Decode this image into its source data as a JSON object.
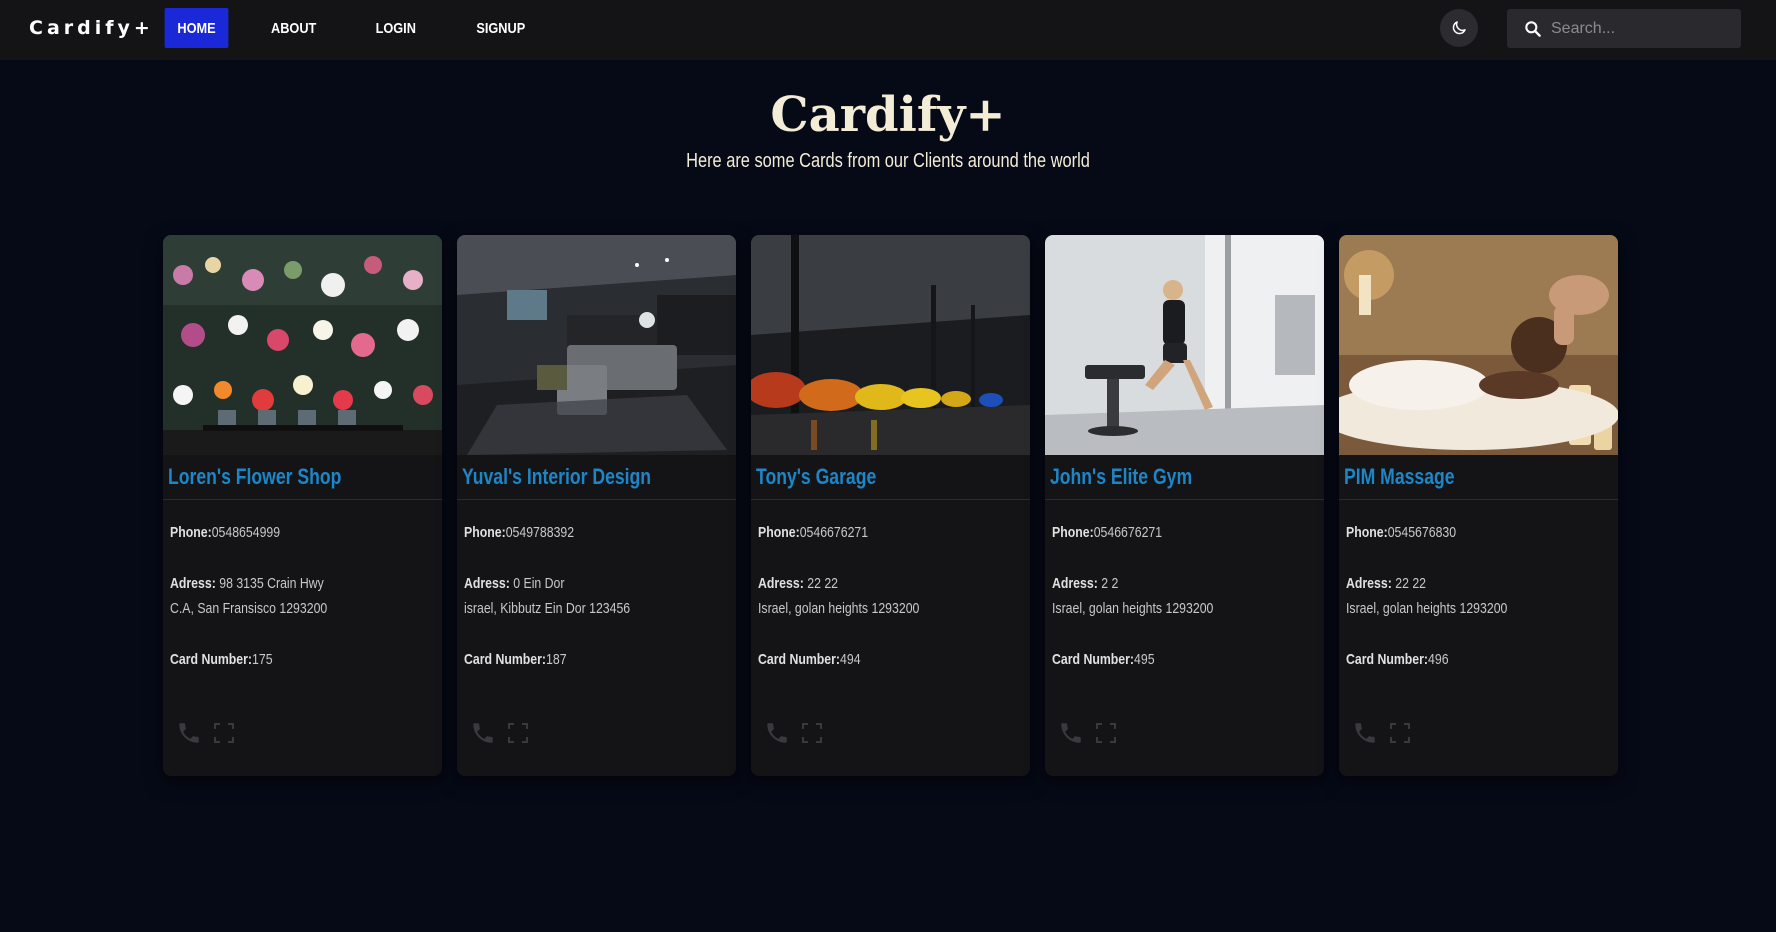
{
  "nav": {
    "brand": "Cardify+",
    "links": [
      "HOME",
      "ABOUT",
      "LOGIN",
      "SIGNUP"
    ],
    "active": "HOME",
    "theme_icon": "moon-icon",
    "search_placeholder": "Search..."
  },
  "hero": {
    "title": "Cardify+",
    "subtitle": "Here are some Cards from our Clients around the world"
  },
  "labels": {
    "phone": "Phone:",
    "address": "Adress:",
    "card_number": "Card Number:"
  },
  "cards": [
    {
      "title": "Loren's Flower Shop",
      "phone": "0548654999",
      "address_line1": "98 3135 Crain Hwy",
      "address_line2": "C.A, San Fransisco 1293200",
      "card_number": "175",
      "image": "flower-shop-photo"
    },
    {
      "title": "Yuval's Interior Design",
      "phone": "0549788392",
      "address_line1": "0 Ein Dor",
      "address_line2": "israel, Kibbutz Ein Dor 123456",
      "card_number": "187",
      "image": "interior-design-photo"
    },
    {
      "title": "Tony's Garage",
      "phone": "0546676271",
      "address_line1": "22 22",
      "address_line2": "Israel, golan heights 1293200",
      "card_number": "494",
      "image": "garage-photo"
    },
    {
      "title": "John's Elite Gym",
      "phone": "0546676271",
      "address_line1": "2 2",
      "address_line2": "Israel, golan heights 1293200",
      "card_number": "495",
      "image": "gym-photo"
    },
    {
      "title": "PIM Massage",
      "phone": "0545676830",
      "address_line1": "22 22",
      "address_line2": "Israel, golan heights 1293200",
      "card_number": "496",
      "image": "massage-photo"
    }
  ],
  "colors": {
    "background": "#060a17",
    "navbar": "#141416",
    "active_nav": "#1a28d8",
    "card": "#141417",
    "card_title": "#1d86c8",
    "hero_text": "#f3ecd6"
  }
}
